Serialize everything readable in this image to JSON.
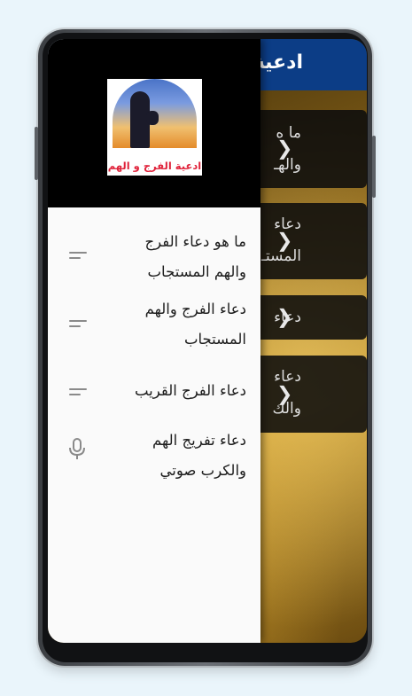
{
  "app": {
    "title": "ادعية",
    "cards": [
      {
        "text": "ما ه",
        "text2": "والهـ"
      },
      {
        "text": "دعاء",
        "text2": "المستـ"
      },
      {
        "text": "دعاء"
      },
      {
        "text": "دعاء",
        "text2": "والك"
      }
    ]
  },
  "drawer": {
    "logo_text": "ادعية الفرج و الهم",
    "items": [
      {
        "label": "ما هو دعاء الفرج والهم المستجاب",
        "icon": "short-text-icon"
      },
      {
        "label": "دعاء الفرج والهم المستجاب",
        "icon": "short-text-icon"
      },
      {
        "label": "دعاء الفرج القريب",
        "icon": "short-text-icon"
      },
      {
        "label": "دعاء تفريج الهم والكرب صوتي",
        "icon": "microphone-icon"
      }
    ]
  },
  "colors": {
    "app_bar": "#0c3d86",
    "drawer_bg": "#fafafa",
    "header_bg": "#000000",
    "icon_gray": "#8a8a8a"
  }
}
